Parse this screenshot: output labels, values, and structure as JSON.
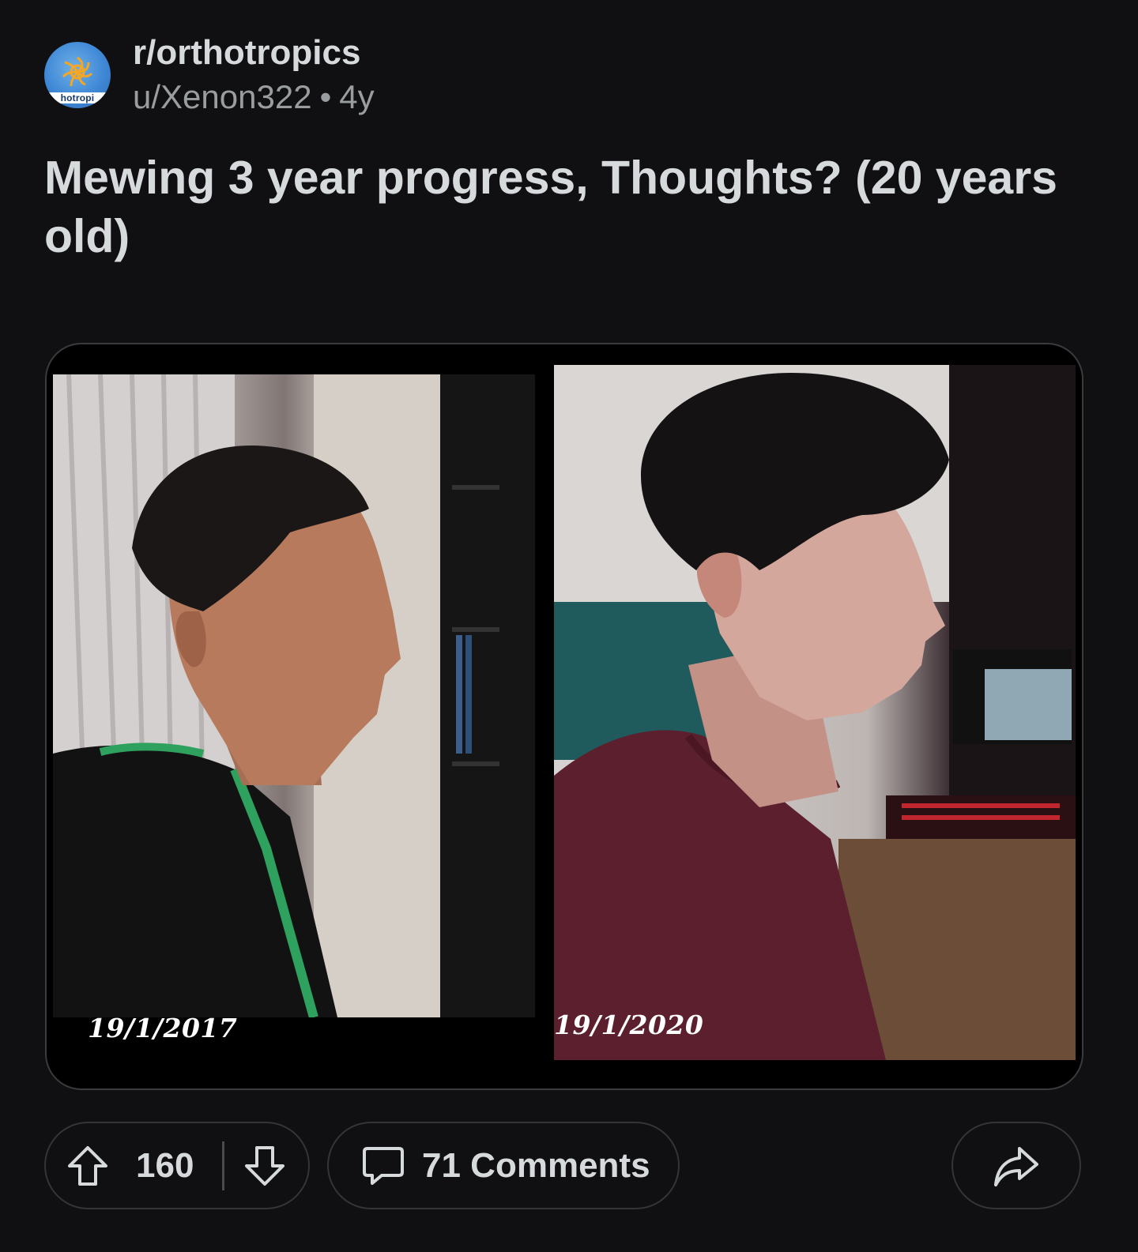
{
  "post": {
    "subreddit": "r/orthotropics",
    "avatar_text": "hotropi",
    "author": "u/Xenon322",
    "separator": "•",
    "age": "4y",
    "title": "Mewing 3 year progress, Thoughts? (20 years old)"
  },
  "media": {
    "left_date": "19/1/2017",
    "right_date": "19/1/2020",
    "left_photo": "profile photo before",
    "right_photo": "profile photo after"
  },
  "actions": {
    "score": "160",
    "comments_label": "71 Comments",
    "upvote_icon": "arrow-up-icon",
    "downvote_icon": "arrow-down-icon",
    "comment_icon": "speech-bubble-icon",
    "share_icon": "share-arrow-icon"
  },
  "colors": {
    "background": "#101012",
    "text": "#d7dadc",
    "muted": "#9a9d9f",
    "border": "#343536",
    "avatar": "#3f88d6"
  }
}
